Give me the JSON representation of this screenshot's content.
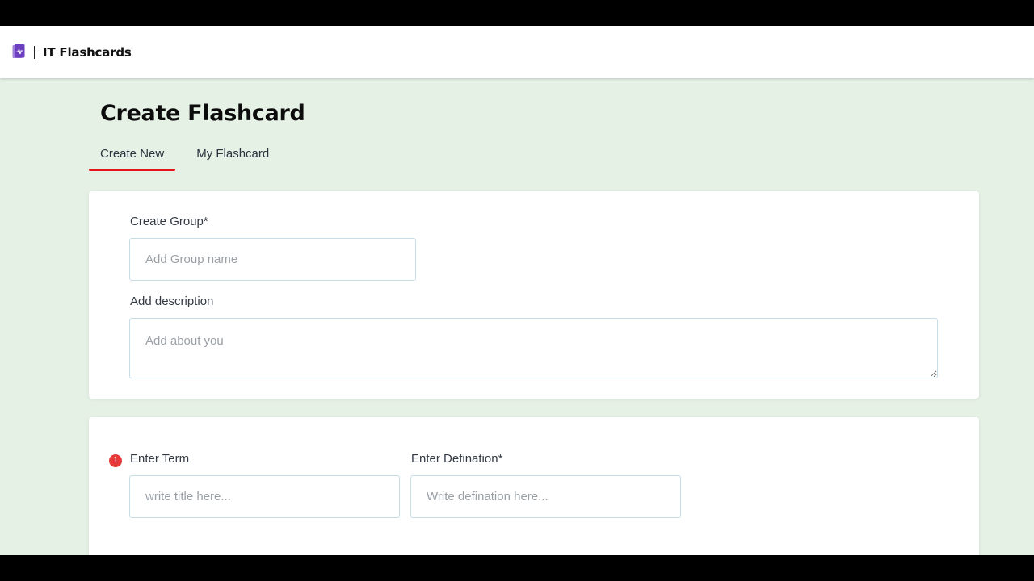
{
  "header": {
    "brand": "IT Flashcards",
    "logo_icon": "flashcard-book-icon",
    "accent_color": "#7b4fc9"
  },
  "page": {
    "title": "Create Flashcard"
  },
  "tabs": [
    {
      "label": "Create New",
      "active": true
    },
    {
      "label": "My Flashcard",
      "active": false
    }
  ],
  "group_form": {
    "group_label": "Create Group*",
    "group_placeholder": "Add Group name",
    "group_value": "",
    "description_label": "Add description",
    "description_placeholder": "Add about you",
    "description_value": ""
  },
  "term_form": {
    "index": "1",
    "term_label": "Enter Term",
    "term_placeholder": "write title here...",
    "definition_label": "Enter Defination*",
    "definition_placeholder": "Write defination here..."
  },
  "colors": {
    "background": "#e6f1e6",
    "active_tab_underline": "#e8121a",
    "badge": "#e63a3a"
  }
}
